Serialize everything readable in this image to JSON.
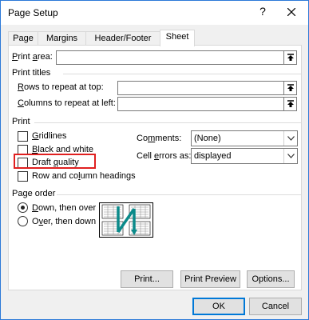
{
  "window": {
    "title": "Page Setup",
    "help_label": "?",
    "close_icon": "close-icon"
  },
  "tabs": [
    {
      "label": "Page",
      "active": false
    },
    {
      "label": "Margins",
      "active": false
    },
    {
      "label": "Header/Footer",
      "active": false
    },
    {
      "label": "Sheet",
      "active": true
    }
  ],
  "print_area": {
    "label": "Print area:",
    "value": ""
  },
  "print_titles": {
    "heading": "Print titles",
    "rows_label": "Rows to repeat at top:",
    "rows_value": "",
    "cols_label": "Columns to repeat at left:",
    "cols_value": ""
  },
  "print": {
    "heading": "Print",
    "gridlines": {
      "label": "Gridlines",
      "checked": false
    },
    "black_white": {
      "label": "Black and white",
      "checked": false
    },
    "draft_quality": {
      "label": "Draft quality",
      "checked": false
    },
    "row_col_headings": {
      "label": "Row and column headings",
      "checked": false
    },
    "comments_label": "Comments:",
    "comments_value": "(None)",
    "cell_errors_label": "Cell errors as:",
    "cell_errors_value": "displayed"
  },
  "page_order": {
    "heading": "Page order",
    "down_then_over": {
      "label": "Down, then over",
      "selected": true
    },
    "over_then_down": {
      "label": "Over, then down",
      "selected": false
    }
  },
  "buttons": {
    "print": "Print...",
    "print_preview": "Print Preview",
    "options": "Options...",
    "ok": "OK",
    "cancel": "Cancel"
  },
  "colors": {
    "highlight": "#e02020",
    "accent": "#0078d7",
    "page_order_arrow": "#0a8a8a"
  }
}
